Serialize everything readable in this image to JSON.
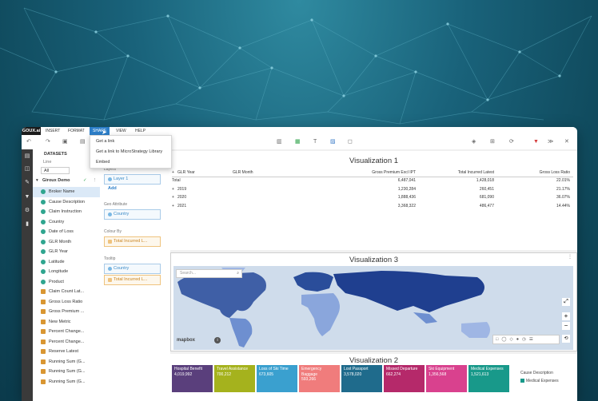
{
  "menubar": {
    "logo": "GOUX.ai",
    "items": [
      "INSERT",
      "FORMAT",
      "SHARE",
      "VIEW",
      "HELP"
    ],
    "active_item": "SHARE"
  },
  "share_menu": {
    "items": [
      "Get a link",
      "Get a link to MicroStrategy Library",
      "Embed"
    ]
  },
  "datasets": {
    "header": "DATASETS",
    "filter_label": "Line",
    "filter_value": "All",
    "dataset_name": "Giroux Demo",
    "items": [
      {
        "label": "Broker Name",
        "kind": "attr"
      },
      {
        "label": "Cause Description",
        "kind": "attr"
      },
      {
        "label": "Claim Instruction",
        "kind": "attr"
      },
      {
        "label": "Country",
        "kind": "attr"
      },
      {
        "label": "Date of Loss",
        "kind": "attr"
      },
      {
        "label": "GLR Month",
        "kind": "attr"
      },
      {
        "label": "GLR Year",
        "kind": "attr"
      },
      {
        "label": "Latitude",
        "kind": "attr"
      },
      {
        "label": "Longitude",
        "kind": "attr"
      },
      {
        "label": "Product",
        "kind": "attr"
      },
      {
        "label": "Claim Count Lat...",
        "kind": "met"
      },
      {
        "label": "Gross Loss Ratio",
        "kind": "met"
      },
      {
        "label": "Gross Premium ...",
        "kind": "met"
      },
      {
        "label": "New Metric",
        "kind": "met"
      },
      {
        "label": "Percent Change...",
        "kind": "met"
      },
      {
        "label": "Percent Change...",
        "kind": "met"
      },
      {
        "label": "Reserve Latest",
        "kind": "met"
      },
      {
        "label": "Running Sum (G...",
        "kind": "met"
      },
      {
        "label": "Running Sum (G...",
        "kind": "met"
      },
      {
        "label": "Running Sum (G...",
        "kind": "met"
      }
    ]
  },
  "properties": {
    "layers_label": "Layers",
    "layer_value": "Layer 1",
    "add_label": "Add",
    "geo_label": "Geo Attribute",
    "geo_value": "Country",
    "colorby_label": "Colour By",
    "colorby_value": "Total Incurred L...",
    "tooltip_label": "Tooltip",
    "tooltip_values": [
      "Country",
      "Total Incurred L..."
    ]
  },
  "viz1": {
    "title": "Visualization 1",
    "headers": [
      "GLR Year",
      "GLR Month",
      "Gross Premium Excl IPT",
      "Total Incurred Latest",
      "Gross Loss Ratio"
    ],
    "rows": [
      {
        "year": "Total",
        "premium": "6,487,041",
        "incurred": "1,428,018",
        "ratio": "22.01%"
      },
      {
        "year": "2019",
        "premium": "1,230,284",
        "incurred": "260,451",
        "ratio": "21.17%"
      },
      {
        "year": "2020",
        "premium": "1,888,436",
        "incurred": "681,090",
        "ratio": "36.07%"
      },
      {
        "year": "2021",
        "premium": "3,368,322",
        "incurred": "486,477",
        "ratio": "14.44%"
      }
    ]
  },
  "viz3": {
    "title": "Visualization 3",
    "search_placeholder": "Search...",
    "attribution": "mapbox"
  },
  "viz2": {
    "title": "Visualization 2",
    "tiles": [
      {
        "label": "Hospital Benefit",
        "value": "4,019,992",
        "color": "#5a3f7c"
      },
      {
        "label": "Travel Assistance",
        "value": "700,212",
        "color": "#a5b21d"
      },
      {
        "label": "Loss of Ski Time",
        "value": "673,605",
        "color": "#3aa0cf"
      },
      {
        "label": "Emergency Baggage",
        "value": "593,266",
        "color": "#f07c7c"
      },
      {
        "label": "Lost Passport",
        "value": "3,578,020",
        "color": "#1f6b8c"
      },
      {
        "label": "Missed Departure",
        "value": "662,274",
        "color": "#b5296a"
      },
      {
        "label": "Ski Equipment",
        "value": "1,356,568",
        "color": "#d9418e"
      },
      {
        "label": "Medical Expenses",
        "value": "1,521,613",
        "color": "#18998a"
      }
    ],
    "legend_title": "Cause Description",
    "legend_item": "Medical Expenses"
  }
}
